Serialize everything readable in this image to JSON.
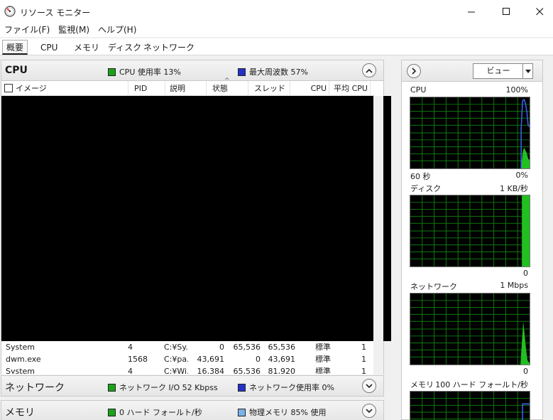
{
  "window": {
    "title": "リソース モニター"
  },
  "menu": [
    "ファイル(F)",
    "監視(M)",
    "ヘルプ(H)"
  ],
  "tabs": [
    "概要",
    "CPU",
    "メモリ",
    "ディスク",
    "ネットワーク"
  ],
  "cpu_section": {
    "title": "CPU",
    "usage_label": "CPU 使用率 13%",
    "freq_label": "最大周波数 57%",
    "columns": [
      "イメージ",
      "PID",
      "説明",
      "状態",
      "スレッド",
      "CPU",
      "平均 CPU"
    ],
    "rows": [
      {
        "image": "System",
        "pid": "4",
        "desc": "C:¥Sy...",
        "c4": "0",
        "c5": "65,536",
        "c6": "65,536",
        "c7": "標準",
        "c8": "1"
      },
      {
        "image": "dwm.exe",
        "pid": "1568",
        "desc": "C:¥pa...",
        "c4": "43,691",
        "c5": "0",
        "c6": "43,691",
        "c7": "標準",
        "c8": "1"
      },
      {
        "image": "System",
        "pid": "4",
        "desc": "C:¥Wi...",
        "c4": "16,384",
        "c5": "65,536",
        "c6": "81,920",
        "c7": "標準",
        "c8": "1"
      }
    ]
  },
  "network_section": {
    "title": "ネットワーク",
    "io_label": "ネットワーク I/O 52 Kbpss",
    "usage_label": "ネットワーク使用率 0%"
  },
  "memory_section": {
    "title": "メモリ",
    "faults_label": "0 ハード フォールト/秒",
    "physical_label": "物理メモリ 85% 使用"
  },
  "graphs_panel": {
    "view_label": "ビュー",
    "graphs": [
      {
        "name": "CPU",
        "top_right": "100%",
        "bottom_left": "60 秒",
        "bottom_right": "0%"
      },
      {
        "name": "ディスク",
        "top_right": "1 KB/秒",
        "bottom_left": "",
        "bottom_right": "0"
      },
      {
        "name": "ネットワーク",
        "top_right": "1 Mbps",
        "bottom_left": "",
        "bottom_right": "0"
      },
      {
        "name": "メモリ",
        "top_right": "100 ハード フォールト/秒",
        "bottom_left": "",
        "bottom_right": ""
      }
    ]
  },
  "colors": {
    "graph_grid": "#0f7a0f",
    "graph_green": "#21c021",
    "graph_blue": "#3a66ff"
  },
  "icons": [
    "resource-monitor-icon",
    "minimize-icon",
    "maximize-icon",
    "close-icon",
    "collapse-chevron-icon",
    "expand-chevron-icon",
    "dropdown-arrow-icon"
  ]
}
